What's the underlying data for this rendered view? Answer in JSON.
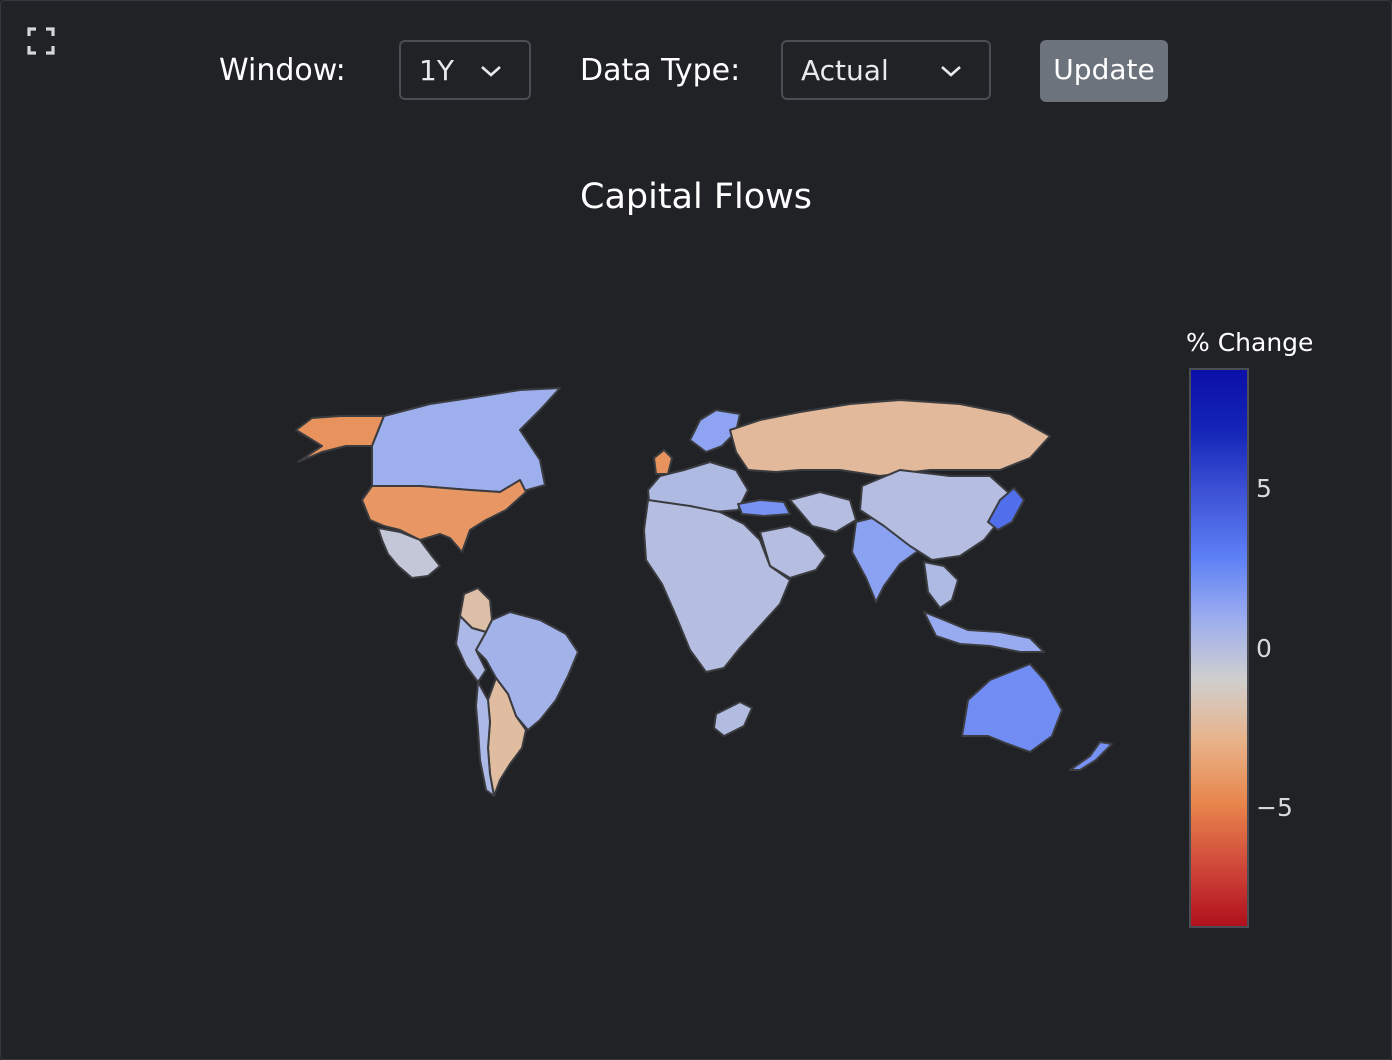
{
  "toolbar": {
    "window_label": "Window:",
    "window_value": "1Y",
    "datatype_label": "Data Type:",
    "datatype_value": "Actual",
    "update_label": "Update"
  },
  "icons": {
    "expand": "fullscreen-expand-icon",
    "chevron": "chevron-down-icon"
  },
  "chart_data": {
    "type": "choropleth",
    "title": "Capital Flows",
    "colorbar": {
      "title": "% Change",
      "range": [
        -8.5,
        8.5
      ],
      "tick_labels": [
        "5",
        "0",
        "−5"
      ],
      "tick_values": [
        5,
        0,
        -5
      ],
      "colorscale": [
        "#b0101c",
        "#d04a3a",
        "#e8864c",
        "#e8b38a",
        "#cfcfcf",
        "#9aacf0",
        "#5c7ef5",
        "#3e53d6",
        "#1526b8",
        "#0a0fa8"
      ]
    },
    "regions": [
      {
        "name": "Alaska",
        "value": -4.2
      },
      {
        "name": "Canada",
        "value": 0.8
      },
      {
        "name": "United States",
        "value": -4.0
      },
      {
        "name": "Mexico",
        "value": -0.5
      },
      {
        "name": "Colombia",
        "value": -2.0
      },
      {
        "name": "Brazil",
        "value": 0.6
      },
      {
        "name": "Peru",
        "value": 0.3
      },
      {
        "name": "Argentina",
        "value": -2.2
      },
      {
        "name": "Chile",
        "value": 0.3
      },
      {
        "name": "United Kingdom",
        "value": -4.2
      },
      {
        "name": "Scandinavia",
        "value": 1.3
      },
      {
        "name": "Western Europe",
        "value": 0.2
      },
      {
        "name": "Russia",
        "value": -2.4
      },
      {
        "name": "Turkey",
        "value": 2.0
      },
      {
        "name": "Saudi Arabia",
        "value": 0.0
      },
      {
        "name": "Iran",
        "value": 0.0
      },
      {
        "name": "India",
        "value": 1.4
      },
      {
        "name": "China",
        "value": 0.0
      },
      {
        "name": "Japan",
        "value": 3.5
      },
      {
        "name": "Southeast Asia",
        "value": 0.2
      },
      {
        "name": "Indonesia",
        "value": 1.0
      },
      {
        "name": "Australia",
        "value": 2.2
      },
      {
        "name": "New Zealand",
        "value": 2.0
      },
      {
        "name": "South Africa",
        "value": 0.1
      },
      {
        "name": "Africa",
        "value": 0.0
      }
    ]
  }
}
